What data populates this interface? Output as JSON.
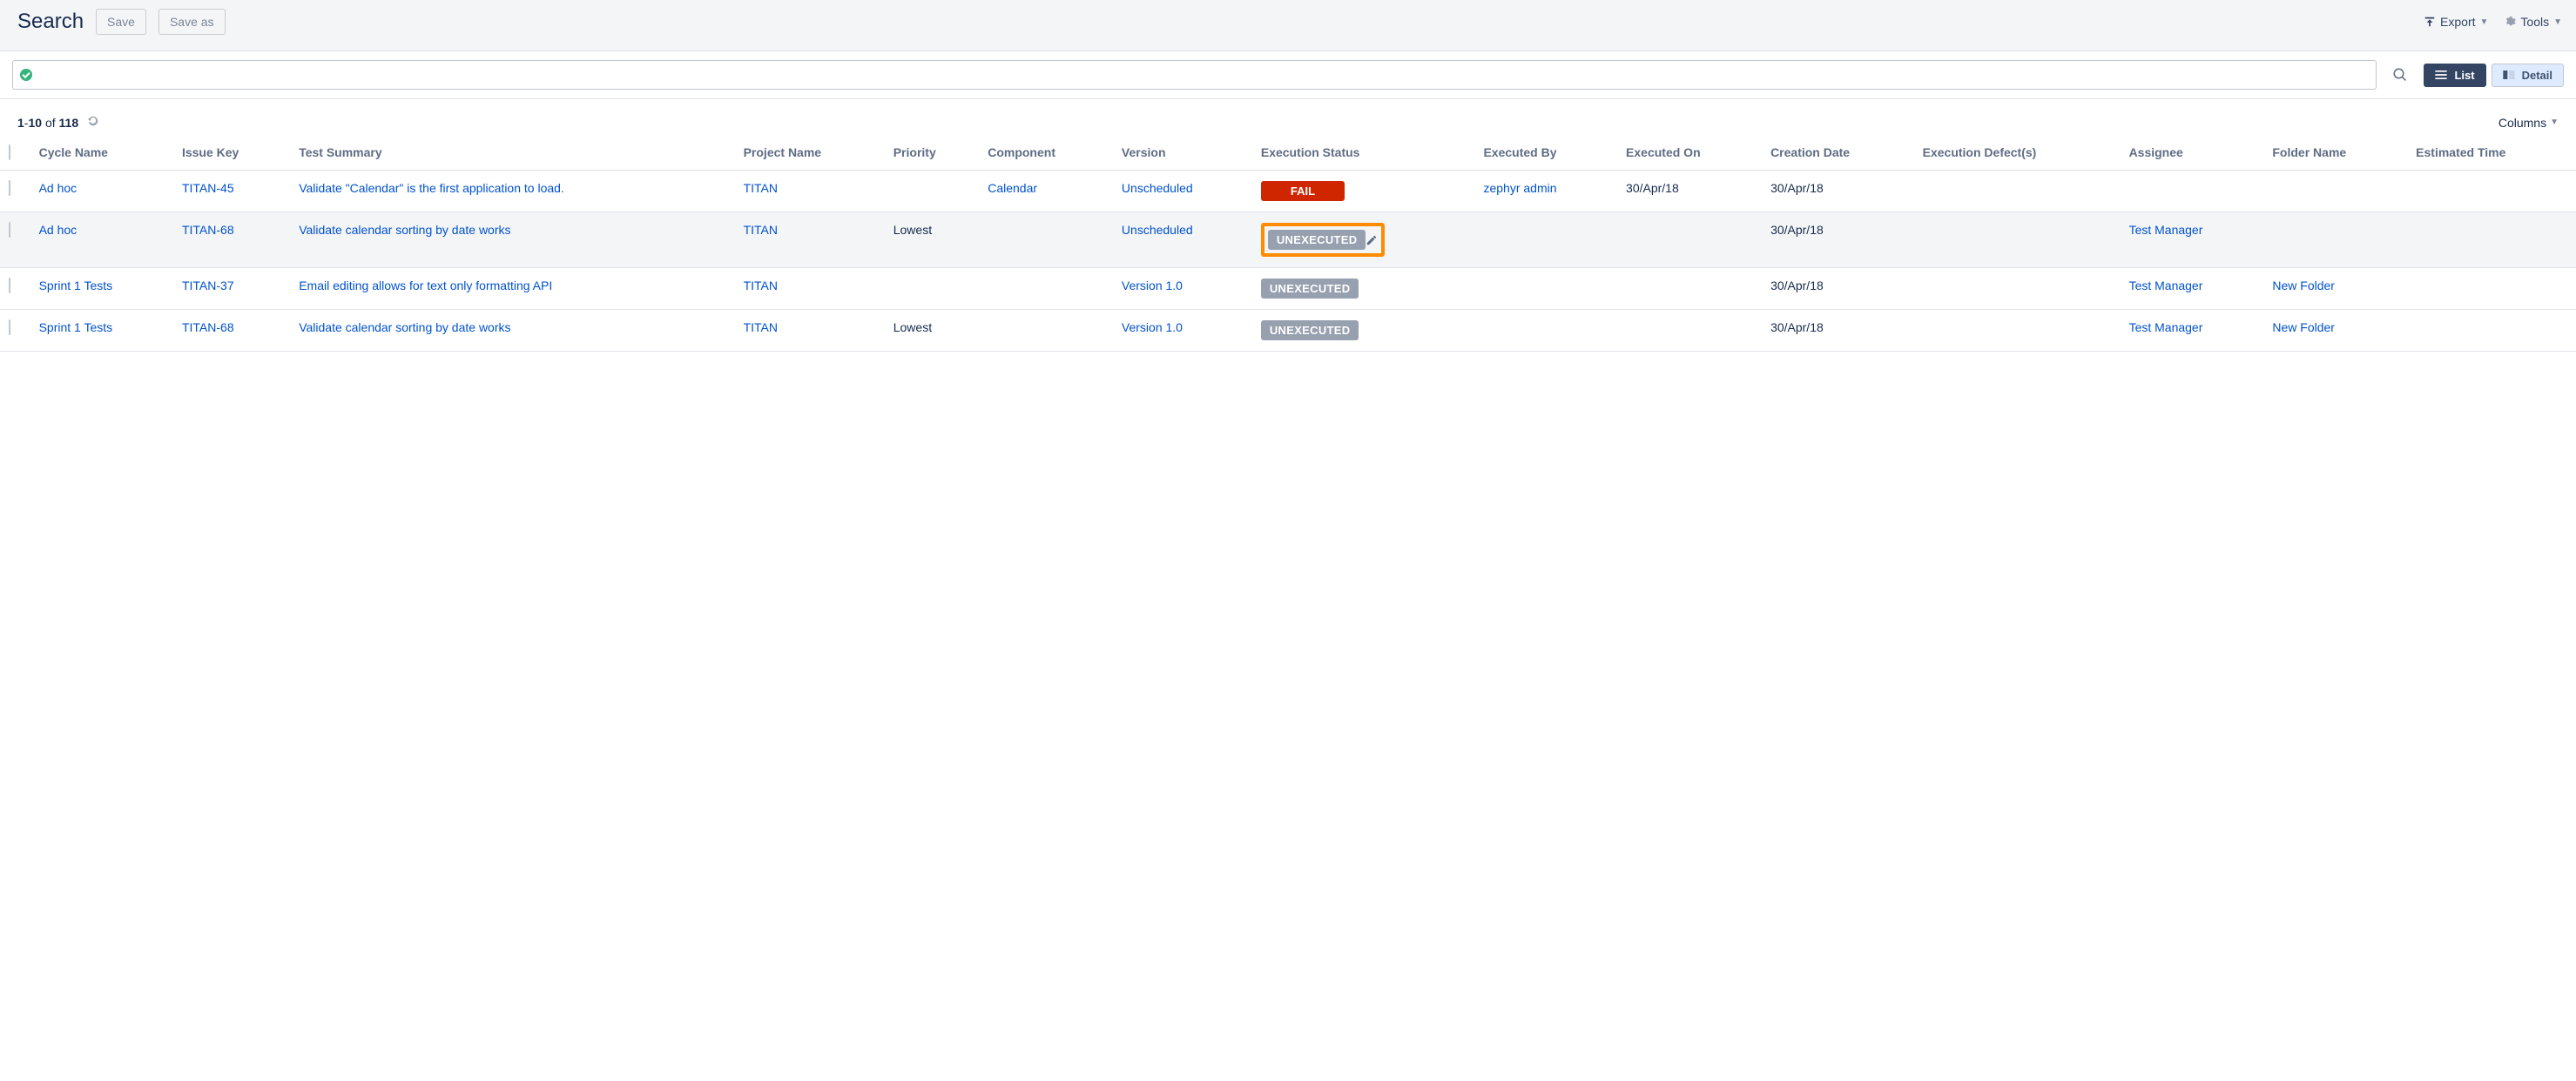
{
  "header": {
    "title": "Search",
    "save": "Save",
    "saveAs": "Save as",
    "export": "Export",
    "tools": "Tools"
  },
  "views": {
    "list": "List",
    "detail": "Detail"
  },
  "meta": {
    "from": "1",
    "to": "10",
    "of_word": "of",
    "total": "118",
    "columns": "Columns"
  },
  "columns": {
    "cycle": "Cycle Name",
    "issue": "Issue Key",
    "summary": "Test Summary",
    "project": "Project Name",
    "priority": "Priority",
    "component": "Component",
    "version": "Version",
    "execStatus": "Execution Status",
    "execBy": "Executed By",
    "execOn": "Executed On",
    "creation": "Creation Date",
    "defects": "Execution Defect(s)",
    "assignee": "Assignee",
    "folder": "Folder Name",
    "estimated": "Estimated Time"
  },
  "rows": [
    {
      "cycle": "Ad hoc",
      "issue": "TITAN-45",
      "summary": "Validate \"Calendar\" is the first application to load.",
      "project": "TITAN",
      "priority": "",
      "component": "Calendar",
      "version": "Unscheduled",
      "status": "FAIL",
      "statusKind": "fail",
      "execBy": "zephyr admin",
      "execOn": "30/Apr/18",
      "creation": "30/Apr/18",
      "defects": "",
      "assignee": "",
      "folder": "",
      "highlight": false
    },
    {
      "cycle": "Ad hoc",
      "issue": "TITAN-68",
      "summary": "Validate calendar sorting by date works",
      "project": "TITAN",
      "priority": "Lowest",
      "component": "",
      "version": "Unscheduled",
      "status": "UNEXECUTED",
      "statusKind": "unexec",
      "execBy": "",
      "execOn": "",
      "creation": "30/Apr/18",
      "defects": "",
      "assignee": "Test Manager",
      "folder": "",
      "highlight": true
    },
    {
      "cycle": "Sprint 1 Tests",
      "issue": "TITAN-37",
      "summary": "Email editing allows for text only formatting API",
      "project": "TITAN",
      "priority": "",
      "component": "",
      "version": "Version 1.0",
      "status": "UNEXECUTED",
      "statusKind": "unexec",
      "execBy": "",
      "execOn": "",
      "creation": "30/Apr/18",
      "defects": "",
      "assignee": "Test Manager",
      "folder": "New Folder",
      "highlight": false
    },
    {
      "cycle": "Sprint 1 Tests",
      "issue": "TITAN-68",
      "summary": "Validate calendar sorting by date works",
      "project": "TITAN",
      "priority": "Lowest",
      "component": "",
      "version": "Version 1.0",
      "status": "UNEXECUTED",
      "statusKind": "unexec",
      "execBy": "",
      "execOn": "",
      "creation": "30/Apr/18",
      "defects": "",
      "assignee": "Test Manager",
      "folder": "New Folder",
      "highlight": false
    }
  ]
}
